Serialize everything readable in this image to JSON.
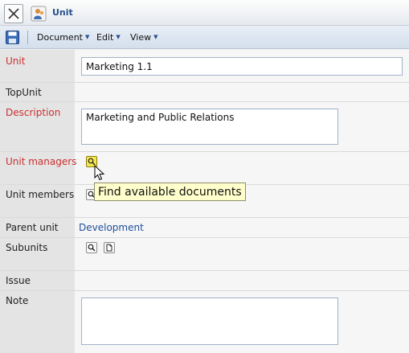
{
  "window": {
    "title": "Unit"
  },
  "toolbar": {
    "menus": [
      "Document",
      "Edit",
      "View"
    ]
  },
  "form": {
    "unit": {
      "label": "Unit",
      "value": "Marketing 1.1"
    },
    "topunit": {
      "label": "TopUnit"
    },
    "description": {
      "label": "Description",
      "value": "Marketing and Public Relations"
    },
    "unit_managers": {
      "label": "Unit managers"
    },
    "unit_members": {
      "label": "Unit members"
    },
    "parent_unit": {
      "label": "Parent unit",
      "value": "Development"
    },
    "subunits": {
      "label": "Subunits"
    },
    "issue": {
      "label": "Issue"
    },
    "note": {
      "label": "Note",
      "value": ""
    }
  },
  "tooltip": {
    "text": "Find available documents"
  },
  "colors": {
    "required_label": "#cc2f2f",
    "link": "#1f4f9c",
    "tooltip_bg": "#ffffcc",
    "active_button": "#f4e64d"
  }
}
